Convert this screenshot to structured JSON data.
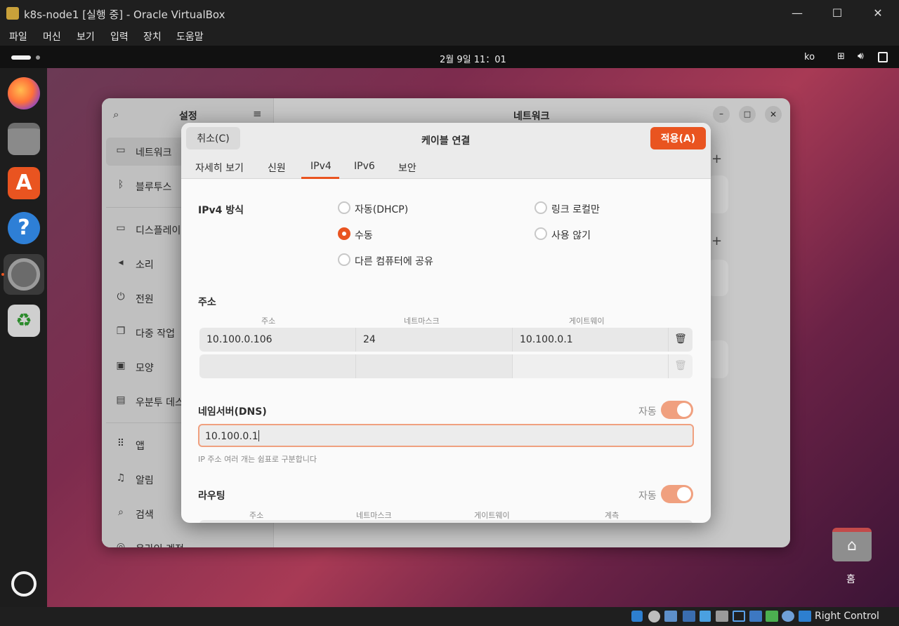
{
  "vbox": {
    "title": "k8s-node1 [실행 중] - Oracle VirtualBox",
    "menu": [
      "파일",
      "머신",
      "보기",
      "입력",
      "장치",
      "도움말"
    ],
    "status_host_key": "Right Control"
  },
  "topbar": {
    "clock": "2월 9일  11：01",
    "lang": "ko"
  },
  "desktop": {
    "home_label": "홈"
  },
  "settings": {
    "sidebar_title": "설정",
    "window_title": "네트워크",
    "sidebar_items": [
      {
        "label": "네트워크",
        "icon": "network-icon"
      },
      {
        "label": "블루투스",
        "icon": "bluetooth-icon"
      },
      {
        "label": "디스플레이",
        "icon": "display-icon"
      },
      {
        "label": "소리",
        "icon": "sound-icon"
      },
      {
        "label": "전원",
        "icon": "power-icon"
      },
      {
        "label": "다중 작업",
        "icon": "multitasking-icon"
      },
      {
        "label": "모양",
        "icon": "appearance-icon"
      },
      {
        "label": "우분투 데스",
        "icon": "ubuntu-desktop-icon"
      },
      {
        "label": "앱",
        "icon": "apps-icon"
      },
      {
        "label": "알림",
        "icon": "bell-icon"
      },
      {
        "label": "검색",
        "icon": "search-icon"
      },
      {
        "label": "온라인 계정",
        "icon": "online-accounts-icon"
      }
    ]
  },
  "dialog": {
    "cancel": "취소(C)",
    "title": "케이블 연결",
    "apply": "적용(A)",
    "tabs": [
      "자세히 보기",
      "신원",
      "IPv4",
      "IPv6",
      "보안"
    ],
    "active_tab": "IPv4",
    "ipv4_method_label": "IPv4 방식",
    "methods": {
      "auto": "자동(DHCP)",
      "link_local": "링크 로컬만",
      "manual": "수동",
      "disabled": "사용 않기",
      "shared": "다른 컴퓨터에 공유"
    },
    "selected_method": "수동",
    "address_section": "주소",
    "address_headers": [
      "주소",
      "네트마스크",
      "게이트웨이"
    ],
    "address_rows": [
      {
        "address": "10.100.0.106",
        "netmask": "24",
        "gateway": "10.100.0.1"
      },
      {
        "address": "",
        "netmask": "",
        "gateway": ""
      }
    ],
    "dns_section": "네임서버(DNS)",
    "dns_auto_label": "자동",
    "dns_value": "10.100.0.1",
    "dns_hint": "IP 주소 여러 개는 쉼표로 구분합니다",
    "routing_section": "라우팅",
    "routing_auto_label": "자동",
    "routing_headers": [
      "주소",
      "네트마스크",
      "게이트웨이",
      "계측"
    ],
    "accent": "#e95420"
  }
}
